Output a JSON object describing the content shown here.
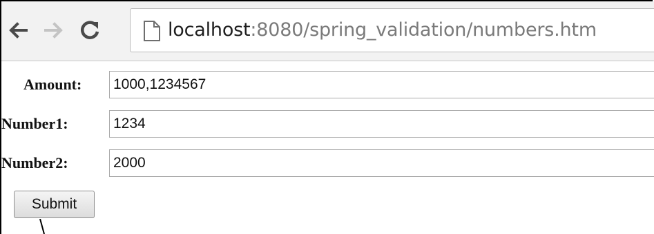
{
  "browser": {
    "address": {
      "host": "localhost",
      "rest": ":8080/spring_validation/numbers.htm"
    },
    "icons": {
      "back": "back-arrow-icon",
      "forward": "forward-arrow-icon",
      "reload": "reload-icon",
      "page": "page-icon"
    }
  },
  "form": {
    "fields": [
      {
        "label": "Amount:",
        "value": "1000,1234567"
      },
      {
        "label": "Number1:",
        "value": "1234"
      },
      {
        "label": "Number2:",
        "value": "2000"
      }
    ],
    "submit_label": "Submit"
  },
  "colors": {
    "toolbar_bg": "#f2f2f2",
    "url_host": "#1f1f1f",
    "url_rest": "#7a7a7a"
  }
}
